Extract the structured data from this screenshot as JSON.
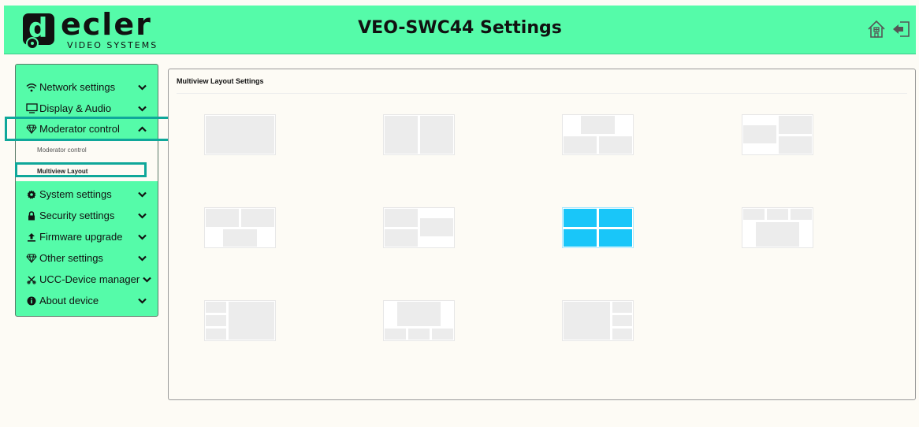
{
  "header": {
    "brand_word": "ecler",
    "brand_sub": "VIDEO SYSTEMS",
    "title": "VEO-SWC44 Settings",
    "icons": [
      "home-icon",
      "exit-icon"
    ]
  },
  "sidebar": {
    "items": [
      {
        "label": "Network settings",
        "icon": "wifi-icon",
        "state": "collapsed"
      },
      {
        "label": "Display & Audio",
        "icon": "monitor-icon",
        "state": "collapsed"
      },
      {
        "label": "Moderator control",
        "icon": "diamond-icon",
        "state": "expanded",
        "highlighted": true
      },
      {
        "label": "System settings",
        "icon": "gear-icon",
        "state": "collapsed"
      },
      {
        "label": "Security settings",
        "icon": "lock-icon",
        "state": "collapsed"
      },
      {
        "label": "Firmware upgrade",
        "icon": "upload-icon",
        "state": "collapsed"
      },
      {
        "label": "Other settings",
        "icon": "diamond-icon",
        "state": "collapsed"
      },
      {
        "label": "UCC-Device manager",
        "icon": "tool-icon",
        "state": "collapsed"
      },
      {
        "label": "About device",
        "icon": "info-icon",
        "state": "collapsed"
      }
    ],
    "submenu": [
      {
        "label": "Moderator control",
        "active": false
      },
      {
        "label": "Multiview Layout",
        "active": true,
        "highlighted": true
      }
    ]
  },
  "main": {
    "title": "Multiview Layout Settings",
    "selected_layout": 7,
    "layouts": [
      "single-layout",
      "side-by-side-layout",
      "one-top-two-bottom-layout",
      "one-left-two-right-layout",
      "two-top-one-bottom-layout",
      "two-left-one-right-layout",
      "quad-layout",
      "three-top-one-bottom-layout",
      "three-left-one-right-layout",
      "one-top-three-bottom-layout",
      "one-left-three-right-layout"
    ]
  },
  "colors": {
    "accent": "#55fba9",
    "highlight": "#0fa79a",
    "selected": "#19c6f9",
    "background": "#fdfbf5"
  }
}
